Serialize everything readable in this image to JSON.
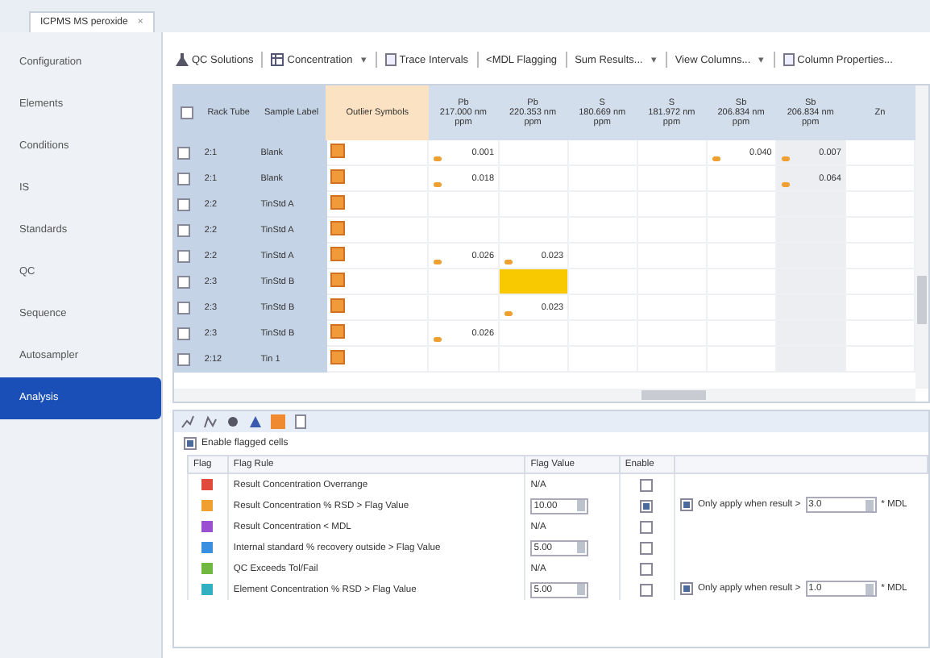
{
  "doc_tab": {
    "title": "ICPMS MS peroxide",
    "close": "×"
  },
  "sidebar": {
    "items": [
      {
        "label": "Configuration",
        "selected": false
      },
      {
        "label": "Elements",
        "selected": false
      },
      {
        "label": "Conditions",
        "selected": false
      },
      {
        "label": "IS",
        "selected": false
      },
      {
        "label": "Standards",
        "selected": false
      },
      {
        "label": "QC",
        "selected": false
      },
      {
        "label": "Sequence",
        "selected": false
      },
      {
        "label": "Autosampler",
        "selected": false
      },
      {
        "label": "Analysis",
        "selected": true
      }
    ]
  },
  "toolbar": [
    {
      "label": "QC Solutions",
      "kind": "flask"
    },
    {
      "label": "Concentration",
      "kind": "grid",
      "arrow": "▾"
    },
    {
      "label": "Trace Intervals",
      "kind": "doc"
    },
    {
      "label": "<MDL Flagging",
      "kind": "none"
    },
    {
      "label": "Sum Results...",
      "kind": "none",
      "arrow": "▾"
    },
    {
      "label": "View Columns...",
      "kind": "none",
      "arrow": "▾"
    },
    {
      "label": "Column Properties...",
      "kind": "doc"
    }
  ],
  "grid": {
    "all_checked": false,
    "columns": [
      "Rack Tube",
      "Sample Label",
      "Outlier Symbols"
    ],
    "elements": [
      [
        "Pb",
        "217.000 nm",
        "ppm"
      ],
      [
        "Pb",
        "220.353 nm",
        "ppm"
      ],
      [
        "S",
        "180.669 nm",
        "ppm"
      ],
      [
        "S",
        "181.972 nm",
        "ppm"
      ],
      [
        "Sb",
        "206.834 nm",
        "ppm"
      ],
      [
        "Sb",
        "206.834 nm",
        "ppm"
      ],
      [
        "Zn"
      ]
    ],
    "rows": [
      {
        "rack": "2:1",
        "label": "Blank",
        "checked": false,
        "cells": [
          {
            "text": "0.001",
            "flag": true,
            "highlight": false
          },
          {
            "flag": false,
            "highlight": false
          },
          {
            "flag": false,
            "highlight": false
          },
          {
            "flag": false,
            "highlight": false
          },
          {
            "text": "0.040",
            "flag": true,
            "highlight": false
          },
          {
            "text": "0.007",
            "flag": true,
            "highlight": false
          }
        ]
      },
      {
        "rack": "2:1",
        "label": "Blank",
        "checked": false,
        "cells": [
          {
            "text": "0.018",
            "flag": true,
            "highlight": false
          },
          {
            "flag": false,
            "highlight": false
          },
          {
            "flag": false,
            "highlight": false
          },
          {
            "flag": false,
            "highlight": false
          },
          {
            "flag": false,
            "highlight": false
          },
          {
            "text": "0.064",
            "flag": true,
            "highlight": false
          }
        ]
      },
      {
        "rack": "2:2",
        "label": "TinStd A",
        "checked": false,
        "cells": []
      },
      {
        "rack": "2:2",
        "label": "TinStd A",
        "checked": false,
        "cells": []
      },
      {
        "rack": "2:2",
        "label": "TinStd A",
        "checked": false,
        "cells": [
          {
            "text": "0.026",
            "flag": true,
            "highlight": false
          },
          {
            "text": "0.023",
            "flag": true,
            "highlight": false
          }
        ]
      },
      {
        "rack": "2:3",
        "label": "TinStd B",
        "checked": false,
        "cells": [
          {
            "flag": false,
            "highlight": false
          },
          {
            "flag": false,
            "highlight": true
          }
        ]
      },
      {
        "rack": "2:3",
        "label": "TinStd B",
        "checked": false,
        "cells": [
          {
            "flag": false,
            "highlight": false
          },
          {
            "text": "0.023",
            "flag": true,
            "highlight": false
          }
        ]
      },
      {
        "rack": "2:3",
        "label": "TinStd B",
        "checked": false,
        "cells": [
          {
            "text": "0.026",
            "flag": true,
            "highlight": false
          }
        ]
      },
      {
        "rack": "2:12",
        "label": "Tin 1",
        "checked": false,
        "cells": []
      }
    ]
  },
  "flag_panel": {
    "enable_label": "Enable flagged cells",
    "enabled": true,
    "columns": [
      "Flag",
      "Flag Rule",
      "Flag Value",
      "Enable"
    ],
    "rules": [
      {
        "color": "#e04a3a",
        "rule": "Result Concentration Overrange",
        "value": "N/A",
        "kind": "text",
        "enabled": false
      },
      {
        "color": "#f0a030",
        "rule": "Result Concentration % RSD > Flag Value",
        "value": "10.00",
        "kind": "spin",
        "enabled": true,
        "extra": {
          "checked": true,
          "label": "Only apply when result >",
          "value": "3.0",
          "unit": "* MDL"
        }
      },
      {
        "color": "#9a50d0",
        "rule": "Result Concentration < MDL",
        "value": "N/A",
        "kind": "text",
        "enabled": false
      },
      {
        "color": "#3a90e0",
        "rule": "Internal standard % recovery outside > Flag Value",
        "value": "5.00",
        "kind": "spin",
        "enabled": false
      },
      {
        "color": "#70b840",
        "rule": "QC Exceeds Tol/Fail",
        "value": "N/A",
        "kind": "text",
        "enabled": false
      },
      {
        "color": "#30b0c0",
        "rule": "Element Concentration % RSD > Flag Value",
        "value": "5.00",
        "kind": "spin",
        "enabled": false,
        "extra": {
          "checked": true,
          "label": "Only apply when result >",
          "value": "1.0",
          "unit": "* MDL"
        }
      }
    ]
  }
}
